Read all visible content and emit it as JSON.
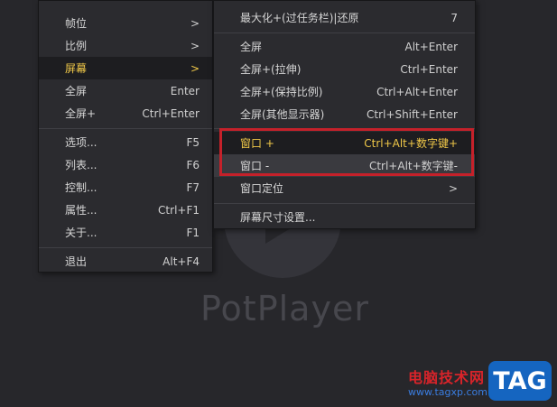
{
  "background": {
    "logo_text": "PotPlayer"
  },
  "left_menu": {
    "items": [
      {
        "label": "帧位",
        "shortcut": ">"
      },
      {
        "label": "比例",
        "shortcut": ">"
      },
      {
        "label": "屏幕",
        "shortcut": ">"
      },
      {
        "label": "全屏",
        "shortcut": "Enter"
      },
      {
        "label": "全屏+",
        "shortcut": "Ctrl+Enter"
      },
      {
        "label": "选项...",
        "shortcut": "F5"
      },
      {
        "label": "列表...",
        "shortcut": "F6"
      },
      {
        "label": "控制...",
        "shortcut": "F7"
      },
      {
        "label": "属性...",
        "shortcut": "Ctrl+F1"
      },
      {
        "label": "关于...",
        "shortcut": "F1"
      },
      {
        "label": "退出",
        "shortcut": "Alt+F4"
      }
    ]
  },
  "right_menu": {
    "items": [
      {
        "label": "最大化+(过任务栏)|还原",
        "shortcut": "7"
      },
      {
        "label": "全屏",
        "shortcut": "Alt+Enter"
      },
      {
        "label": "全屏+(拉伸)",
        "shortcut": "Ctrl+Enter"
      },
      {
        "label": "全屏+(保持比例)",
        "shortcut": "Ctrl+Alt+Enter"
      },
      {
        "label": "全屏(其他显示器)",
        "shortcut": "Ctrl+Shift+Enter"
      },
      {
        "label": "窗口 +",
        "shortcut": "Ctrl+Alt+数字键+"
      },
      {
        "label": "窗口 -",
        "shortcut": "Ctrl+Alt+数字键-"
      },
      {
        "label": "窗口定位",
        "shortcut": ">"
      },
      {
        "label": "屏幕尺寸设置...",
        "shortcut": ""
      }
    ]
  },
  "watermark": {
    "text": "电脑技术网",
    "url": "www.tagxp.com",
    "tag": "TAG"
  },
  "colors": {
    "highlight_text": "#f0c848",
    "annotation_box": "#c5212a"
  }
}
